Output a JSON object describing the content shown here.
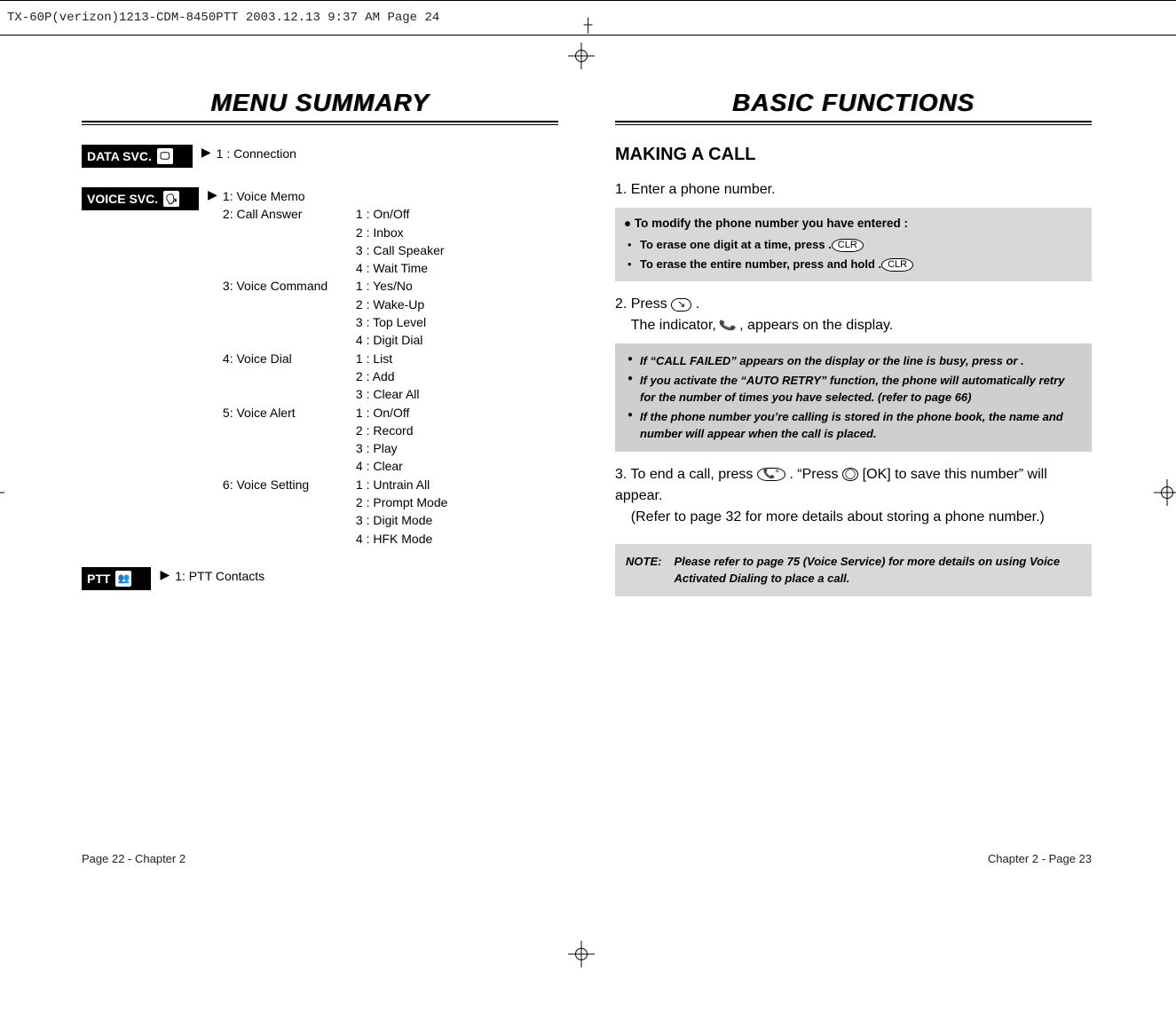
{
  "topbar": "TX-60P(verizon)1213-CDM-8450PTT  2003.12.13  9:37 AM  Page 24",
  "left": {
    "title": "MENU SUMMARY",
    "sections": [
      {
        "badge": "DATA SVC.",
        "icon": "🖵",
        "items": [
          {
            "l2": "1 : Connection",
            "l3": []
          }
        ]
      },
      {
        "badge": "VOICE SVC.",
        "icon": "🗣",
        "items": [
          {
            "l2": "1: Voice Memo",
            "l3": []
          },
          {
            "l2": "2: Call Answer",
            "l3": [
              "1 : On/Off",
              "2 : Inbox",
              "3 : Call Speaker",
              "4 : Wait Time"
            ]
          },
          {
            "l2": "3: Voice Command",
            "l3": [
              "1 : Yes/No",
              "2 : Wake-Up",
              "3 : Top Level",
              "4 : Digit Dial"
            ]
          },
          {
            "l2": "4: Voice Dial",
            "l3": [
              "1 : List",
              "2 : Add",
              "3 : Clear All"
            ]
          },
          {
            "l2": "5: Voice Alert",
            "l3": [
              "1 : On/Off",
              "2 : Record",
              "3 : Play",
              "4 : Clear"
            ]
          },
          {
            "l2": "6: Voice Setting",
            "l3": [
              "1 : Untrain All",
              "2 : Prompt Mode",
              "3 : Digit Mode",
              "4 : HFK Mode"
            ]
          }
        ]
      },
      {
        "badge": "PTT",
        "icon": "👥",
        "items": [
          {
            "l2": "1: PTT Contacts",
            "l3": []
          }
        ]
      }
    ],
    "footer": "Page 22 - Chapter 2"
  },
  "right": {
    "title": "BASIC FUNCTIONS",
    "h2": "MAKING A CALL",
    "step1": "1. Enter a phone number.",
    "box1": {
      "hdr": "To modify the phone number you have entered :",
      "lines": [
        "To erase one digit at a time, press       .",
        "To erase the entire number, press and hold       ."
      ]
    },
    "step2a": "2. Press ",
    "step2b": " .",
    "step2c": "The indicator, ",
    "step2d": " , appears on the display.",
    "box2": [
      "If “CALL FAILED” appears on the display or the line is busy, press        or        .",
      "If you activate the “AUTO RETRY” function, the phone will automatically retry for the number of times you have selected. (refer to page 66)",
      "If the phone number you’re calling is stored in the phone book, the name and number will appear when the call is placed."
    ],
    "step3a": "3. To end a call, press ",
    "step3b": " . “Press ",
    "step3c": " [OK] to save this number” will appear.",
    "step3d": "(Refer to page 32 for more details about storing a phone number.)",
    "note_lbl": "NOTE:",
    "note_txt": "Please refer to page 75 (Voice Service) for more details on using Voice Activated Dialing to place a call.",
    "footer": "Chapter 2 - Page 23"
  }
}
